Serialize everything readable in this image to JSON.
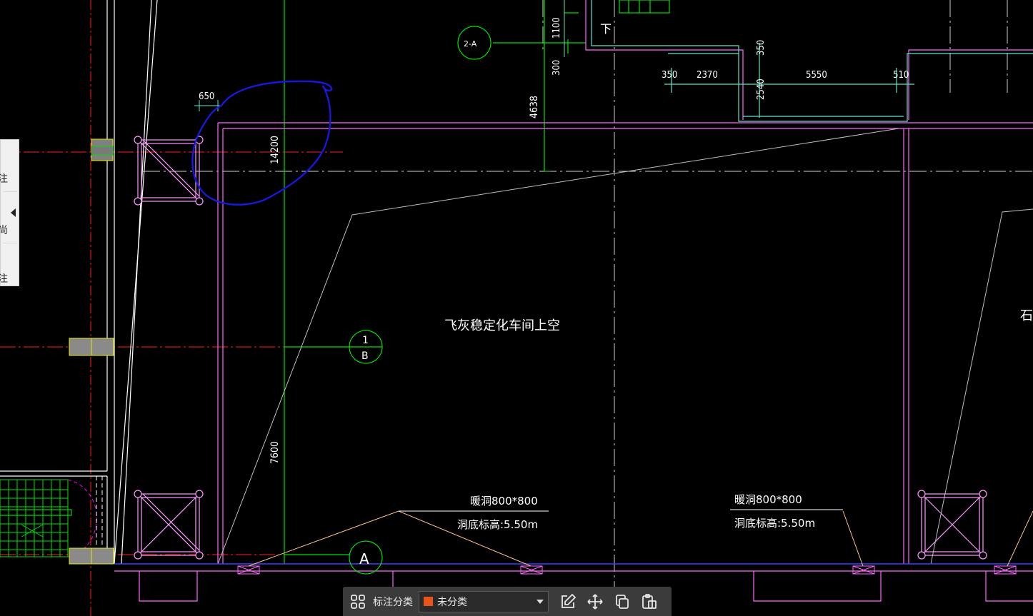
{
  "drawing": {
    "room_label": "飞灰稳定化车间上空",
    "partial_label": "石",
    "stair_label": "下",
    "axis_bubbles": {
      "grid_2a": "2-A",
      "grid_1b_top": "1",
      "grid_1b_bottom": "B",
      "grid_a": "A"
    },
    "dimensions": {
      "d650": "650",
      "d14200": "14200",
      "d4638": "4638",
      "d1100": "1100",
      "d300": "300",
      "d350_top": "350",
      "d350": "350",
      "d2370": "2370",
      "d5550": "5550",
      "d510": "510",
      "d2540": "2540",
      "d7600": "7600"
    },
    "openings": [
      {
        "title": "暖洞800*800",
        "elevation": "洞底标高:5.50m"
      },
      {
        "title": "暖洞800*800",
        "elevation": "洞底标高:5.50m"
      }
    ],
    "colors": {
      "grid_green": "#00ff00",
      "dim_cyan": "#5ce6c8",
      "wall_magenta": "#ff66ff",
      "annotation_blue": "#1818d8",
      "center_red": "#ff2020",
      "outline_white": "#ffffff"
    }
  },
  "side_panel": {
    "chars": [
      "注",
      "尚",
      "注"
    ],
    "arrow_icon": "caret-left-icon"
  },
  "toolbar": {
    "grid_icon": "grid-icon",
    "label": "标注分类",
    "category_value": "未分类",
    "category_color": "#e8541a",
    "tools": [
      "edit-icon",
      "move-icon",
      "copy-icon",
      "paste-icon"
    ]
  }
}
